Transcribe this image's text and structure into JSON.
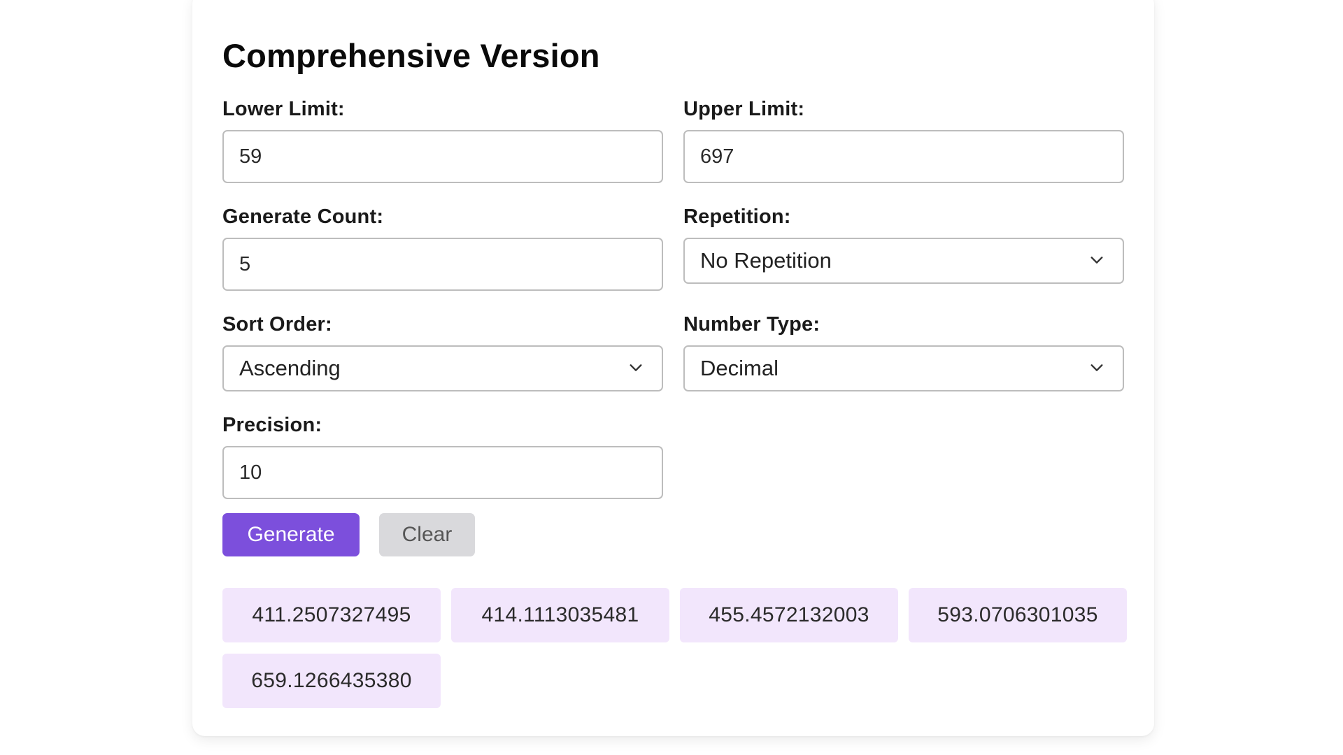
{
  "form": {
    "title": "Comprehensive Version",
    "lower_limit": {
      "label": "Lower Limit:",
      "value": "59"
    },
    "upper_limit": {
      "label": "Upper Limit:",
      "value": "697"
    },
    "generate_count": {
      "label": "Generate Count:",
      "value": "5"
    },
    "repetition": {
      "label": "Repetition:",
      "value": "No Repetition"
    },
    "sort_order": {
      "label": "Sort Order:",
      "value": "Ascending"
    },
    "number_type": {
      "label": "Number Type:",
      "value": "Decimal"
    },
    "precision": {
      "label": "Precision:",
      "value": "10"
    }
  },
  "buttons": {
    "generate_label": "Generate",
    "clear_label": "Clear"
  },
  "results": [
    "411.2507327495",
    "414.1113035481",
    "455.4572132003",
    "593.0706301035",
    "659.1266435380"
  ],
  "colors": {
    "accent": "#7c4fdc",
    "result_chip": "#f2e6fc",
    "clear_button": "#d9d9dc"
  },
  "icons": {
    "select_chevron": "chevron-down-icon"
  }
}
